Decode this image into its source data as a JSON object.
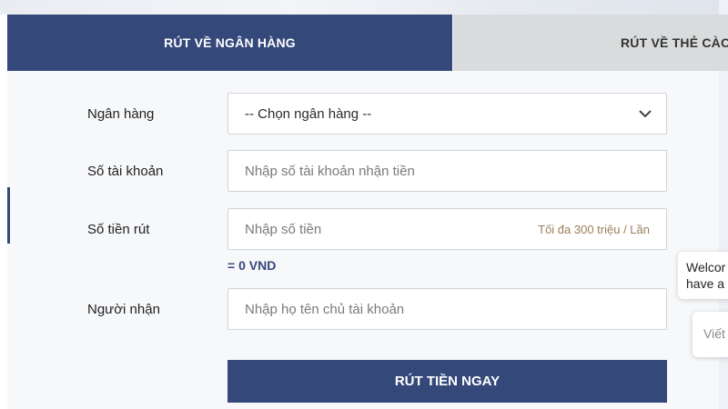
{
  "tabs": {
    "bank_label": "RÚT VỀ NGÂN HÀNG",
    "card_label": "RÚT VỀ THẺ CÀO"
  },
  "form": {
    "bank": {
      "label": "Ngân hàng",
      "value": "-- Chọn ngân hàng --"
    },
    "account": {
      "label": "Số tài khoản",
      "placeholder": "Nhập số tài khoản nhận tiền"
    },
    "amount": {
      "label": "Số tiền rút",
      "placeholder": "Nhập số tiền",
      "hint": "Tối đa 300 triệu / Lần",
      "converted": "= 0 VND"
    },
    "recipient": {
      "label": "Người nhận",
      "placeholder": "Nhập họ tên chủ tài khoản"
    },
    "submit_label": "RÚT TIỀN NGAY"
  },
  "chat": {
    "welcome_line1": "Welcor",
    "welcome_line2": "have a",
    "input_placeholder": "Viết"
  },
  "colors": {
    "primary": "#34487a",
    "tab_inactive": "#d9dbdc",
    "hint": "#9a7f5a"
  }
}
